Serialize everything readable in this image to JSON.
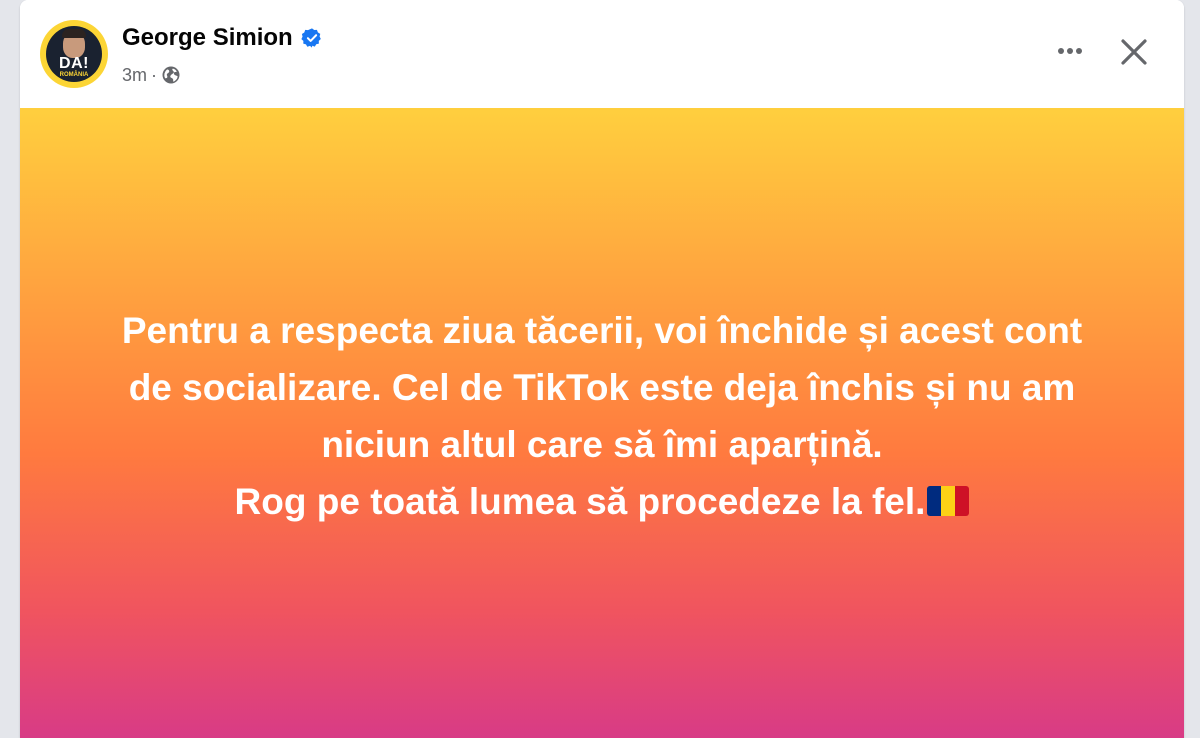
{
  "post": {
    "author": "George Simion",
    "time": "3m",
    "separator": "·",
    "avatar_text": "DA!",
    "avatar_subtext": "ROMÂNIA",
    "lines": [
      "Pentru a respecta ziua tăcerii, voi închide și acest cont",
      "de socializare. Cel de TikTok este deja închis și nu am",
      "niciun altul care să îmi aparțină.",
      "Rog pe toată lumea să procedeze la fel."
    ],
    "emoji": "romania-flag",
    "background_colors": [
      "#ffcf3e",
      "#ff7a3f",
      "#d83b86"
    ]
  },
  "icons": {
    "verified": "verified-badge-icon",
    "privacy": "globe-icon",
    "more": "more-options-icon",
    "close": "close-icon"
  },
  "colors": {
    "accent": "#1877f2",
    "text": "#050505",
    "meta": "#65676b"
  }
}
